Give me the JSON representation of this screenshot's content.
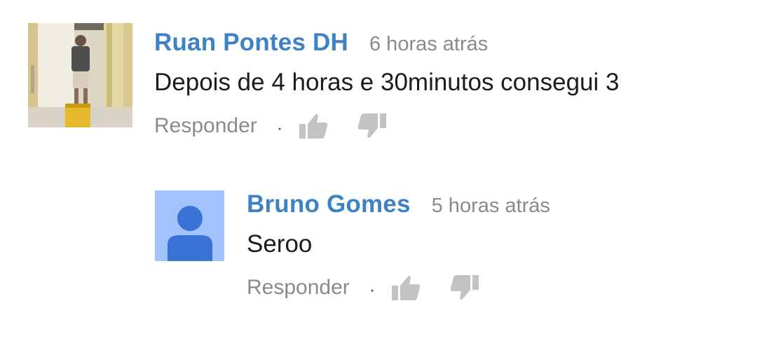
{
  "comments": [
    {
      "author": "Ruan Pontes DH",
      "time": "6 horas atrás",
      "text": "Depois de 4 horas e 30minutos consegui 3",
      "reply_label": "Responder",
      "separator": "·",
      "like_icon": "thumbs-up-icon",
      "dislike_icon": "thumbs-down-icon"
    },
    {
      "author": "Bruno Gomes",
      "time": "5 horas atrás",
      "text": "Seroo",
      "reply_label": "Responder",
      "separator": "·",
      "like_icon": "thumbs-up-icon",
      "dislike_icon": "thumbs-down-icon"
    }
  ],
  "colors": {
    "author": "#3e82c4",
    "meta": "#8a8a8a",
    "text": "#1c1c1c",
    "icon": "#c3c3c3",
    "default_avatar_bg": "#a1c2fa",
    "default_avatar_fg": "#3a73d6"
  }
}
